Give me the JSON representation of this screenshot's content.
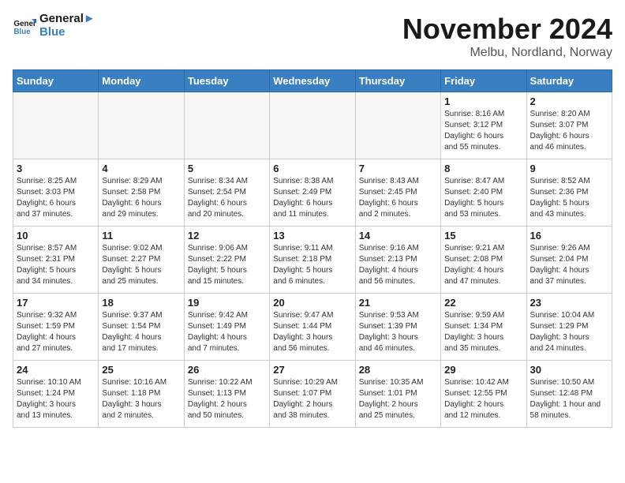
{
  "logo": {
    "line1": "General",
    "line2": "Blue"
  },
  "title": "November 2024",
  "subtitle": "Melbu, Nordland, Norway",
  "weekdays": [
    "Sunday",
    "Monday",
    "Tuesday",
    "Wednesday",
    "Thursday",
    "Friday",
    "Saturday"
  ],
  "weeks": [
    [
      {
        "day": "",
        "info": ""
      },
      {
        "day": "",
        "info": ""
      },
      {
        "day": "",
        "info": ""
      },
      {
        "day": "",
        "info": ""
      },
      {
        "day": "",
        "info": ""
      },
      {
        "day": "1",
        "info": "Sunrise: 8:16 AM\nSunset: 3:12 PM\nDaylight: 6 hours\nand 55 minutes."
      },
      {
        "day": "2",
        "info": "Sunrise: 8:20 AM\nSunset: 3:07 PM\nDaylight: 6 hours\nand 46 minutes."
      }
    ],
    [
      {
        "day": "3",
        "info": "Sunrise: 8:25 AM\nSunset: 3:03 PM\nDaylight: 6 hours\nand 37 minutes."
      },
      {
        "day": "4",
        "info": "Sunrise: 8:29 AM\nSunset: 2:58 PM\nDaylight: 6 hours\nand 29 minutes."
      },
      {
        "day": "5",
        "info": "Sunrise: 8:34 AM\nSunset: 2:54 PM\nDaylight: 6 hours\nand 20 minutes."
      },
      {
        "day": "6",
        "info": "Sunrise: 8:38 AM\nSunset: 2:49 PM\nDaylight: 6 hours\nand 11 minutes."
      },
      {
        "day": "7",
        "info": "Sunrise: 8:43 AM\nSunset: 2:45 PM\nDaylight: 6 hours\nand 2 minutes."
      },
      {
        "day": "8",
        "info": "Sunrise: 8:47 AM\nSunset: 2:40 PM\nDaylight: 5 hours\nand 53 minutes."
      },
      {
        "day": "9",
        "info": "Sunrise: 8:52 AM\nSunset: 2:36 PM\nDaylight: 5 hours\nand 43 minutes."
      }
    ],
    [
      {
        "day": "10",
        "info": "Sunrise: 8:57 AM\nSunset: 2:31 PM\nDaylight: 5 hours\nand 34 minutes."
      },
      {
        "day": "11",
        "info": "Sunrise: 9:02 AM\nSunset: 2:27 PM\nDaylight: 5 hours\nand 25 minutes."
      },
      {
        "day": "12",
        "info": "Sunrise: 9:06 AM\nSunset: 2:22 PM\nDaylight: 5 hours\nand 15 minutes."
      },
      {
        "day": "13",
        "info": "Sunrise: 9:11 AM\nSunset: 2:18 PM\nDaylight: 5 hours\nand 6 minutes."
      },
      {
        "day": "14",
        "info": "Sunrise: 9:16 AM\nSunset: 2:13 PM\nDaylight: 4 hours\nand 56 minutes."
      },
      {
        "day": "15",
        "info": "Sunrise: 9:21 AM\nSunset: 2:08 PM\nDaylight: 4 hours\nand 47 minutes."
      },
      {
        "day": "16",
        "info": "Sunrise: 9:26 AM\nSunset: 2:04 PM\nDaylight: 4 hours\nand 37 minutes."
      }
    ],
    [
      {
        "day": "17",
        "info": "Sunrise: 9:32 AM\nSunset: 1:59 PM\nDaylight: 4 hours\nand 27 minutes."
      },
      {
        "day": "18",
        "info": "Sunrise: 9:37 AM\nSunset: 1:54 PM\nDaylight: 4 hours\nand 17 minutes."
      },
      {
        "day": "19",
        "info": "Sunrise: 9:42 AM\nSunset: 1:49 PM\nDaylight: 4 hours\nand 7 minutes."
      },
      {
        "day": "20",
        "info": "Sunrise: 9:47 AM\nSunset: 1:44 PM\nDaylight: 3 hours\nand 56 minutes."
      },
      {
        "day": "21",
        "info": "Sunrise: 9:53 AM\nSunset: 1:39 PM\nDaylight: 3 hours\nand 46 minutes."
      },
      {
        "day": "22",
        "info": "Sunrise: 9:59 AM\nSunset: 1:34 PM\nDaylight: 3 hours\nand 35 minutes."
      },
      {
        "day": "23",
        "info": "Sunrise: 10:04 AM\nSunset: 1:29 PM\nDaylight: 3 hours\nand 24 minutes."
      }
    ],
    [
      {
        "day": "24",
        "info": "Sunrise: 10:10 AM\nSunset: 1:24 PM\nDaylight: 3 hours\nand 13 minutes."
      },
      {
        "day": "25",
        "info": "Sunrise: 10:16 AM\nSunset: 1:18 PM\nDaylight: 3 hours\nand 2 minutes."
      },
      {
        "day": "26",
        "info": "Sunrise: 10:22 AM\nSunset: 1:13 PM\nDaylight: 2 hours\nand 50 minutes."
      },
      {
        "day": "27",
        "info": "Sunrise: 10:29 AM\nSunset: 1:07 PM\nDaylight: 2 hours\nand 38 minutes."
      },
      {
        "day": "28",
        "info": "Sunrise: 10:35 AM\nSunset: 1:01 PM\nDaylight: 2 hours\nand 25 minutes."
      },
      {
        "day": "29",
        "info": "Sunrise: 10:42 AM\nSunset: 12:55 PM\nDaylight: 2 hours\nand 12 minutes."
      },
      {
        "day": "30",
        "info": "Sunrise: 10:50 AM\nSunset: 12:48 PM\nDaylight: 1 hour and\n58 minutes."
      }
    ]
  ]
}
